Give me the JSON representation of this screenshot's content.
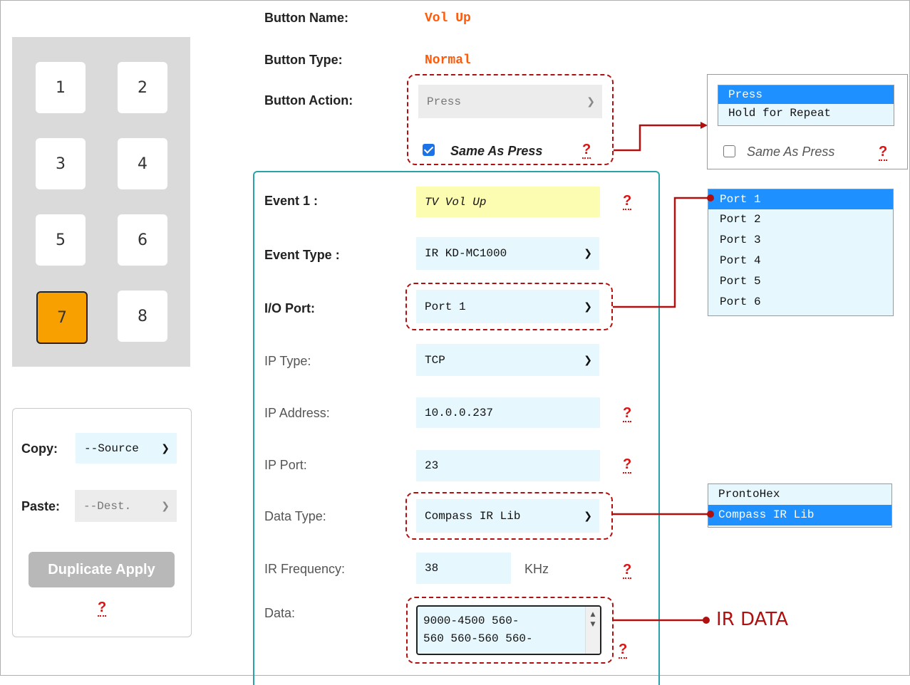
{
  "keypad": {
    "keys": [
      "1",
      "2",
      "3",
      "4",
      "5",
      "6",
      "7",
      "8"
    ],
    "active_key": "7"
  },
  "copy_panel": {
    "copy_label": "Copy:",
    "copy_value": "--Source",
    "paste_label": "Paste:",
    "paste_value": "--Dest.",
    "duplicate_button": "Duplicate Apply",
    "help": "?"
  },
  "button_config": {
    "name_label": "Button Name:",
    "name_value": "Vol Up",
    "type_label": "Button Type:",
    "type_value": "Normal",
    "action_label": "Button Action:",
    "action_value": "Press",
    "same_as_press_label": "Same As Press",
    "same_as_press_checked": true,
    "help": "?"
  },
  "action_popup": {
    "options": [
      "Press",
      "Hold for Repeat"
    ],
    "selected": "Press",
    "same_as_press_label": "Same As Press",
    "same_as_press_checked": false,
    "help": "?"
  },
  "event": {
    "event_label": "Event 1 :",
    "event_value": "TV Vol Up",
    "event_type_label": "Event Type :",
    "event_type_value": "IR KD-MC1000",
    "io_port_label": "I/O Port:",
    "io_port_value": "Port 1",
    "ip_type_label": "IP Type:",
    "ip_type_value": "TCP",
    "ip_address_label": "IP Address:",
    "ip_address_value": "10.0.0.237",
    "ip_port_label": "IP Port:",
    "ip_port_value": "23",
    "data_type_label": "Data Type:",
    "data_type_value": "Compass IR Lib",
    "ir_frequency_label": "IR Frequency:",
    "ir_frequency_value": "38",
    "ir_frequency_unit": "KHz",
    "data_label": "Data:",
    "data_line1": "9000-4500 560-",
    "data_line2": "560 560-560 560-",
    "help": "?"
  },
  "port_popup": {
    "options": [
      "Port 1",
      "Port 2",
      "Port 3",
      "Port 4",
      "Port 5",
      "Port 6"
    ],
    "selected": "Port 1"
  },
  "data_type_popup": {
    "options": [
      "ProntoHex",
      "Compass IR Lib"
    ],
    "selected": "Compass IR Lib"
  },
  "annotation": {
    "ir_data_label": "IR DATA"
  },
  "colors": {
    "accent_orange": "#ff5a0a",
    "active_key": "#f7a000",
    "field_bg": "#e6f7fd",
    "event_name_bg": "#fdfdb2",
    "callout_red": "#b01010",
    "help_red": "#e01010",
    "panel_teal": "#2aa3a8",
    "selected_option": "#1e90ff"
  }
}
